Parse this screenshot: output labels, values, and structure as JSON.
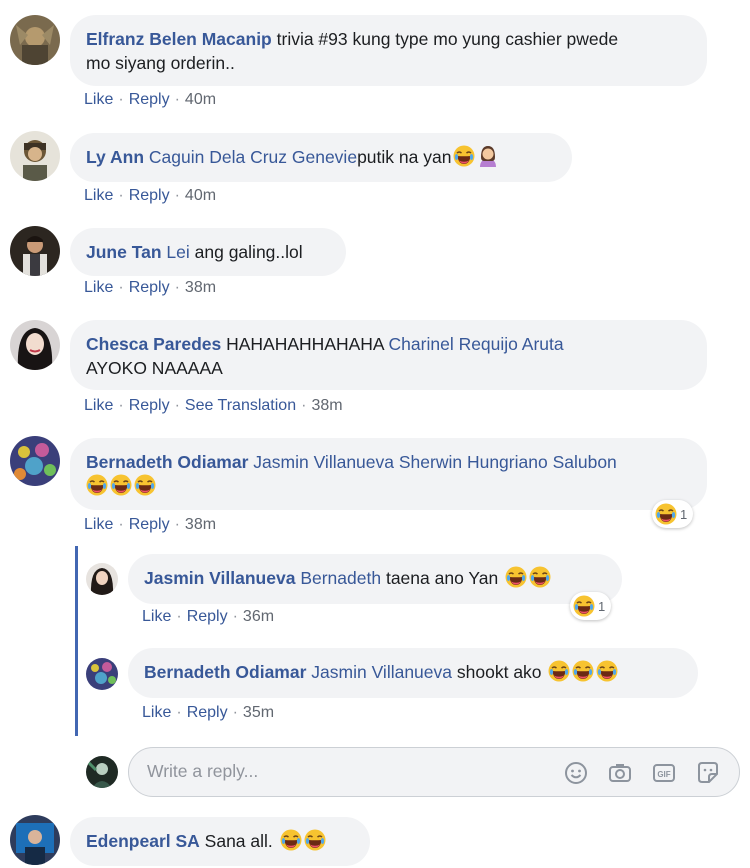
{
  "actions": {
    "like": "Like",
    "reply": "Reply",
    "see_translation": "See Translation"
  },
  "comments": [
    {
      "author": "Elfranz Belen Macanip",
      "line1": "trivia #93 kung type mo yung cashier pwede",
      "line2": "mo siyang orderin..",
      "time": "40m"
    },
    {
      "author": "Ly Ann",
      "mention": "Caguin Dela Cruz Genevie",
      "text": "putik na yan",
      "time": "40m"
    },
    {
      "author": "June Tan",
      "mention": "Lei",
      "text": "ang galing..lol",
      "time": "38m"
    },
    {
      "author": "Chesca Paredes",
      "text": "HAHAHAHHAHAHA",
      "mention": "Charinel Requijo Aruta",
      "line2": "AYOKO NAAAAA",
      "time": "38m"
    },
    {
      "author": "Bernadeth Odiamar",
      "mention": "Jasmin Villanueva Sherwin Hungriano Salubon",
      "time": "38m",
      "reaction_count": "1"
    },
    {
      "author": "Edenpearl SA",
      "text": "Sana all.",
      "time": ""
    }
  ],
  "replies": [
    {
      "author": "Jasmin Villanueva",
      "mention": "Bernadeth",
      "text": "taena ano Yan",
      "time": "36m",
      "reaction_count": "1"
    },
    {
      "author": "Bernadeth Odiamar",
      "mention": "Jasmin Villanueva",
      "text": "shookt ako",
      "time": "35m"
    }
  ],
  "reply_box": {
    "placeholder": "Write a reply..."
  },
  "icons": {
    "emoji": "laughing-emoji",
    "woman": "woman-emoji",
    "smile": "smile-icon",
    "camera": "camera-icon",
    "gif": "gif-icon",
    "sticker": "sticker-icon"
  },
  "colors": {
    "link": "#385898",
    "bubble": "#f2f3f5",
    "thread_line": "#4267b2",
    "meta": "#616770"
  }
}
